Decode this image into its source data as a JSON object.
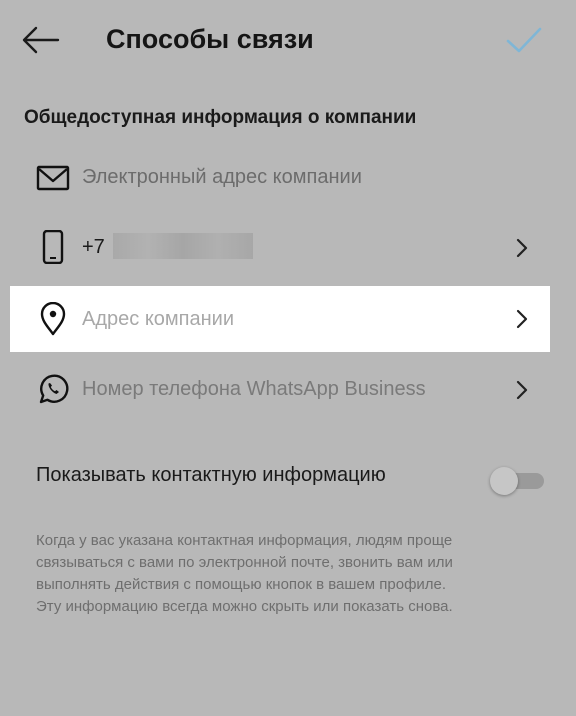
{
  "header": {
    "title": "Способы связи",
    "back_icon": "arrow-left-icon",
    "confirm_icon": "checkmark-icon",
    "confirm_color": "#7fb6d6"
  },
  "section": {
    "title": "Общедоступная информация о компании"
  },
  "rows": {
    "email": {
      "icon": "mail-icon",
      "placeholder": "Электронный адрес компании"
    },
    "phone": {
      "icon": "smartphone-icon",
      "value": "+7"
    },
    "address": {
      "icon": "location-pin-icon",
      "placeholder": "Адрес компании"
    },
    "whatsapp": {
      "icon": "whatsapp-icon",
      "placeholder": "Номер телефона WhatsApp Business"
    }
  },
  "toggle": {
    "label": "Показывать контактную информацию",
    "enabled": false
  },
  "description": {
    "lines": [
      "Когда у вас указана контактная информация, людям проще",
      "связываться с вами по электронной почте, звонить вам или",
      "выполнять действия с помощью кнопок в вашем профиле.",
      "Эту информацию всегда можно скрыть или показать снова."
    ]
  },
  "colors": {
    "overlay_background": "#b8b8b8",
    "highlight_row": "#ffffff"
  }
}
